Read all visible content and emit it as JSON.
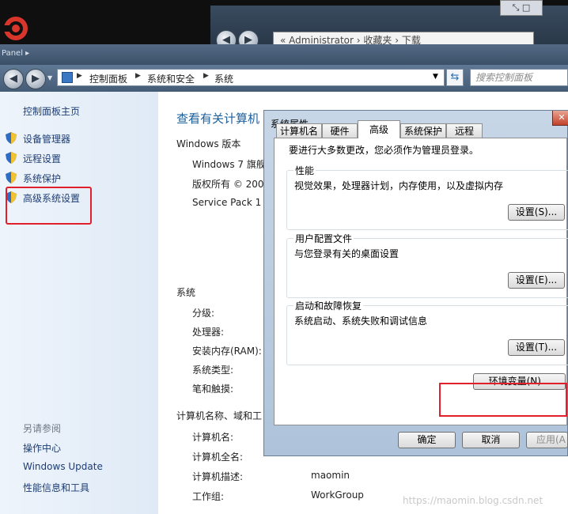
{
  "background": {
    "back_window_path": "« Administrator › 收藏夹 › 下载"
  },
  "window": {
    "title": "Panel ▸"
  },
  "nav": {
    "breadcrumbs": [
      "控制面板",
      "系统和安全",
      "系统"
    ],
    "search_placeholder": "搜索控制面板"
  },
  "left_pane": {
    "home": "控制面板主页",
    "links": [
      "设备管理器",
      "远程设置",
      "系统保护",
      "高级系统设置"
    ],
    "see_also_label": "另请参阅",
    "see_also": [
      "操作中心",
      "Windows Update",
      "性能信息和工具"
    ]
  },
  "content": {
    "title": "查看有关计算机",
    "edition_header": "Windows 版本",
    "edition": "Windows 7 旗舰",
    "copyright": "版权所有 © 200",
    "service_pack": "Service Pack 1",
    "system_header": "系统",
    "rating_label": "分级:",
    "processor_label": "处理器:",
    "ram_label": "安装内存(RAM):",
    "system_type_label": "系统类型:",
    "pen_label": "笔和触摸:",
    "computer_header": "计算机名称、域和工",
    "computer_name_label": "计算机名:",
    "full_name_label": "计算机全名:",
    "description_label": "计算机描述:",
    "description_value": "maomin",
    "workgroup_label": "工作组:",
    "workgroup_value": "WorkGroup"
  },
  "dialog": {
    "title": "系统属性",
    "close": "✕",
    "tabs": [
      "计算机名",
      "硬件",
      "高级",
      "系统保护",
      "远程"
    ],
    "active_tab": "高级",
    "admin_note": "要进行大多数更改，您必须作为管理员登录。",
    "performance": {
      "title": "性能",
      "desc": "视觉效果，处理器计划，内存使用，以及虚拟内存",
      "button": "设置(S)..."
    },
    "user_profiles": {
      "title": "用户配置文件",
      "desc": "与您登录有关的桌面设置",
      "button": "设置(E)..."
    },
    "startup": {
      "title": "启动和故障恢复",
      "desc": "系统启动、系统失败和调试信息",
      "button": "设置(T)..."
    },
    "env_button": "环境变量(N)...",
    "ok": "确定",
    "cancel": "取消",
    "apply": "应用(A"
  },
  "watermark": "https://maomin.blog.csdn.net",
  "colors": {
    "link": "#1d3d75",
    "title_blue": "#1d5f9a",
    "highlight": "#e0202a"
  }
}
